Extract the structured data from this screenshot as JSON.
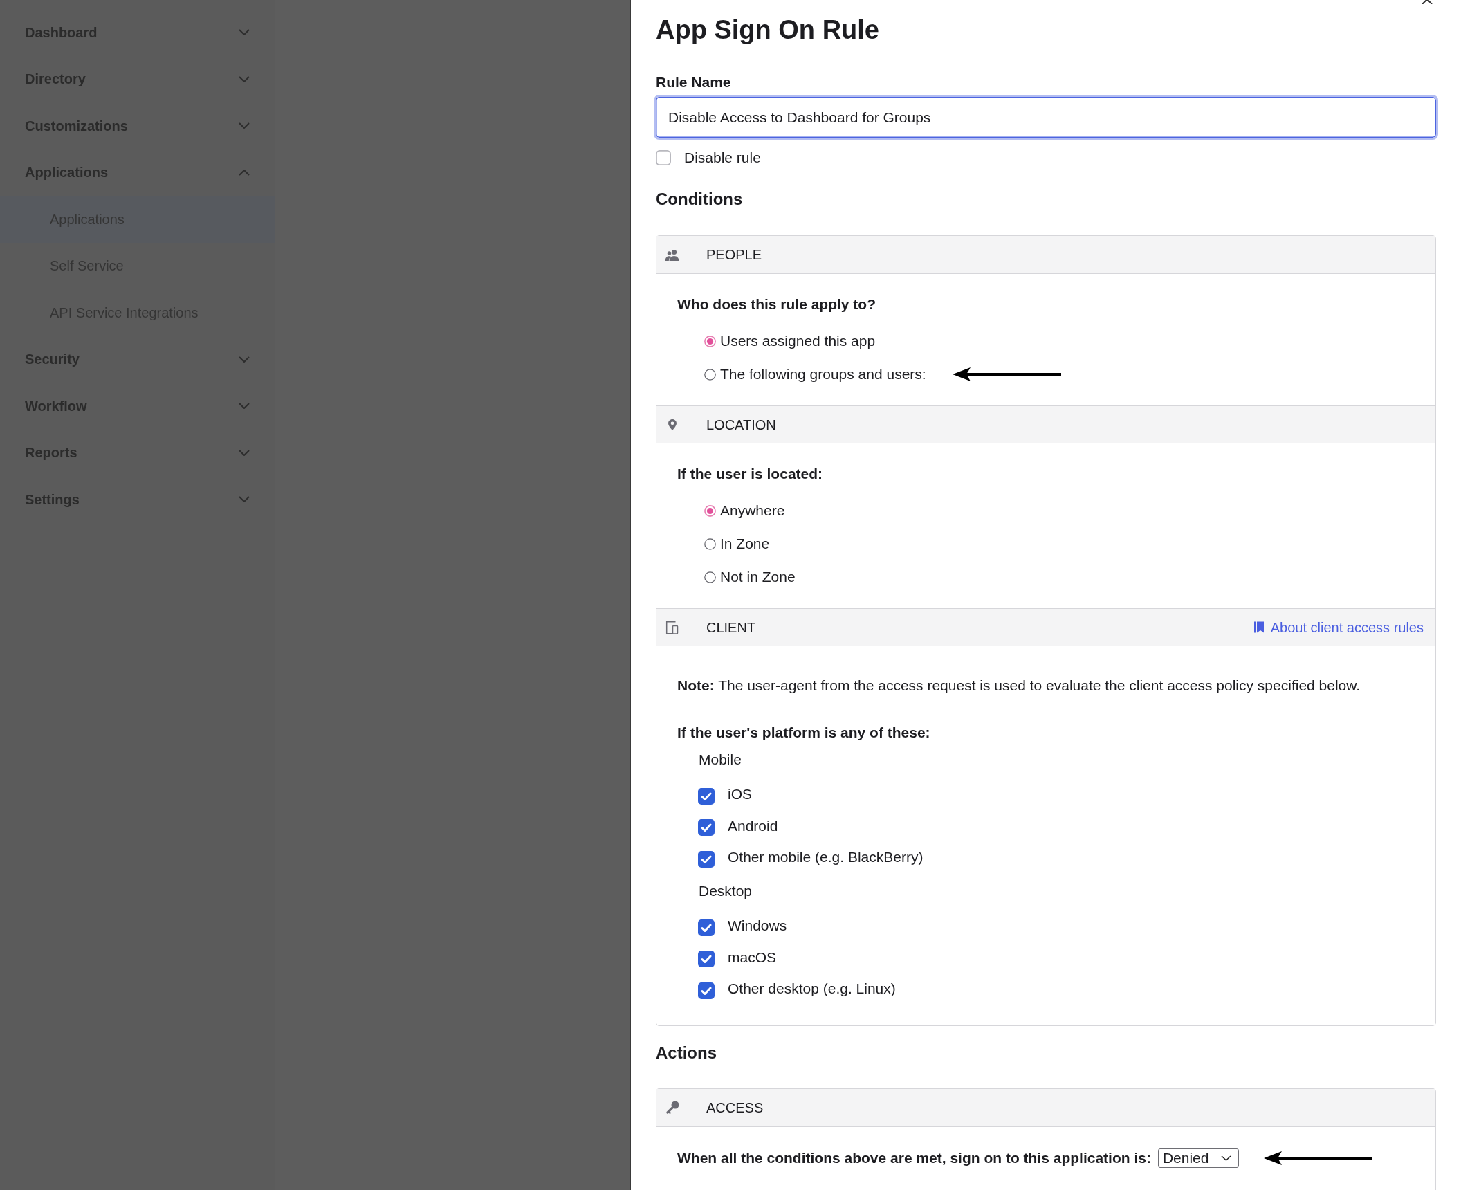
{
  "sidebar": {
    "items": [
      {
        "label": "Dashboard",
        "expanded": false
      },
      {
        "label": "Directory",
        "expanded": false
      },
      {
        "label": "Customizations",
        "expanded": false
      },
      {
        "label": "Applications",
        "expanded": true,
        "children": [
          {
            "label": "Applications",
            "selected": true
          },
          {
            "label": "Self Service",
            "selected": false
          },
          {
            "label": "API Service Integrations",
            "selected": false
          }
        ]
      },
      {
        "label": "Security",
        "expanded": false
      },
      {
        "label": "Workflow",
        "expanded": false
      },
      {
        "label": "Reports",
        "expanded": false
      },
      {
        "label": "Settings",
        "expanded": false
      }
    ]
  },
  "dialog": {
    "title": "App Sign On Rule",
    "rule_name": {
      "label": "Rule Name",
      "value": "Disable Access to Dashboard for Groups",
      "focused": true
    },
    "disable_rule": {
      "label": "Disable rule",
      "checked": false
    },
    "conditions": {
      "heading": "Conditions",
      "sections": [
        {
          "kind": "people",
          "title": "PEOPLE",
          "question": "Who does this rule apply to?",
          "options": [
            {
              "label": "Users assigned this app",
              "selected": true,
              "arrow": false
            },
            {
              "label": "The following groups and users:",
              "selected": false,
              "arrow": true
            }
          ]
        },
        {
          "kind": "location",
          "title": "LOCATION",
          "question": "If the user is located:",
          "options": [
            {
              "label": "Anywhere",
              "selected": true
            },
            {
              "label": "In Zone",
              "selected": false
            },
            {
              "label": "Not in Zone",
              "selected": false
            }
          ]
        },
        {
          "kind": "client",
          "title": "CLIENT",
          "link": "About client access rules",
          "note": "**Note:** The user-agent from the access request is used to evaluate the client access policy specified below.",
          "question": "If the user's platform is any of these:",
          "groups": [
            {
              "label": "Mobile",
              "options": [
                {
                  "label": "iOS",
                  "checked": true
                },
                {
                  "label": "Android",
                  "checked": true
                },
                {
                  "label": "Other mobile (e.g. BlackBerry)",
                  "checked": true
                }
              ]
            },
            {
              "label": "Desktop",
              "options": [
                {
                  "label": "Windows",
                  "checked": true
                },
                {
                  "label": "macOS",
                  "checked": true
                },
                {
                  "label": "Other desktop (e.g. Linux)",
                  "checked": true
                }
              ]
            }
          ]
        }
      ]
    },
    "actions": {
      "heading": "Actions",
      "sections": [
        {
          "kind": "access",
          "title": "ACCESS",
          "prompt": "When all the conditions above are met, sign on to this application is:",
          "select": {
            "value": "Denied"
          },
          "arrow": true
        }
      ]
    }
  }
}
